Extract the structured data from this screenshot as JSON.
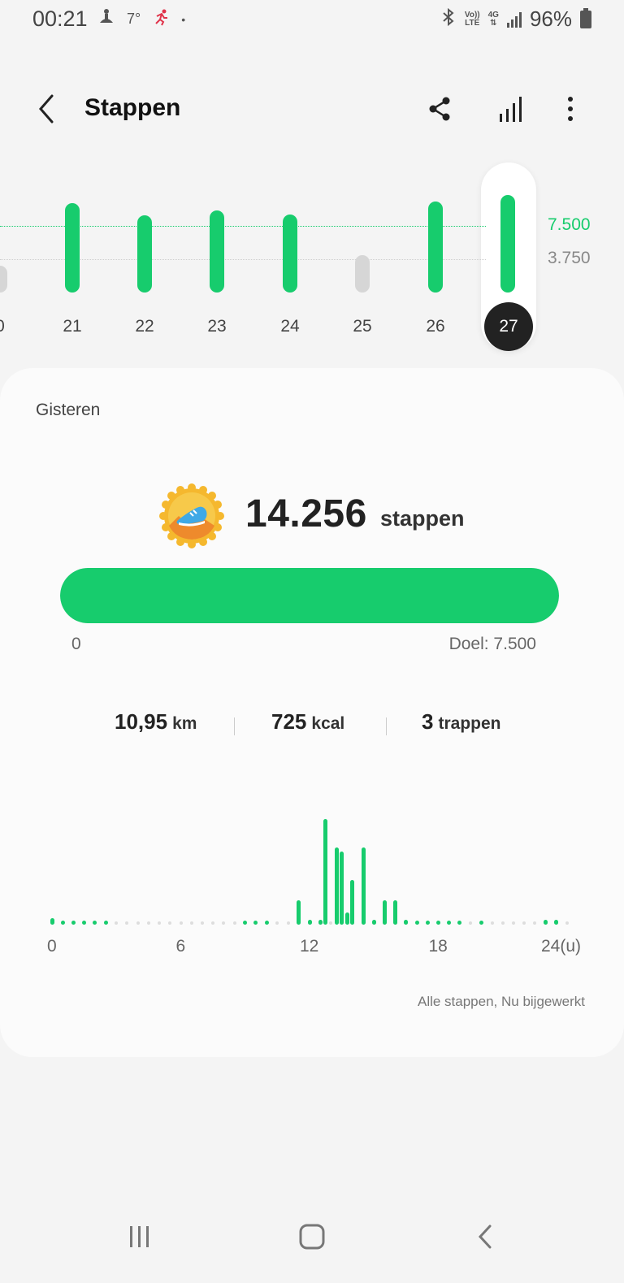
{
  "status_bar": {
    "time": "00:21",
    "temperature": "7°",
    "battery": "96%",
    "volte": "Vo)) LTE",
    "network": "4G"
  },
  "header": {
    "title": "Stappen",
    "back_icon": "chevron-left-icon",
    "share_icon": "share-icon",
    "trends_icon": "bar-chart-icon",
    "more_icon": "more-vertical-icon"
  },
  "week_chart": {
    "days": [
      "0",
      "21",
      "22",
      "23",
      "24",
      "25",
      "26",
      "27"
    ],
    "steps": [
      3000,
      10100,
      8700,
      9300,
      8800,
      4200,
      10300,
      11000
    ],
    "goal_reached": [
      false,
      true,
      true,
      true,
      true,
      false,
      true,
      true
    ],
    "selected_day": "27",
    "goal_label": "7.500",
    "half_goal_label": "3.750",
    "goal_value": 7500,
    "half_goal_value": 3750,
    "colors": {
      "green": "#17cc6d",
      "grey": "#d6d6d6"
    }
  },
  "card": {
    "day_label": "Gisteren",
    "steps_count": "14.256",
    "steps_unit": "stappen",
    "progress_fraction": 1.0,
    "progress_min": "0",
    "progress_goal": "Doel: 7.500",
    "distance_value": "10,95",
    "distance_unit": "km",
    "calories_value": "725",
    "calories_unit": "kcal",
    "floors_value": "3",
    "floors_unit": "trappen",
    "hour_labels": [
      "0",
      "6",
      "12",
      "18",
      "24(u)"
    ],
    "footnote": "Alle stappen, Nu bijgewerkt"
  },
  "chart_data": {
    "type": "bar",
    "title": "",
    "xlabel": "",
    "ylabel": "",
    "x_unit": "u",
    "x_range": [
      0,
      24
    ],
    "x": [
      0,
      0.5,
      1,
      1.5,
      2,
      2.5,
      9,
      9.5,
      10,
      11.5,
      12,
      12.5,
      12.75,
      13.25,
      13.5,
      13.75,
      14,
      14.5,
      15,
      15.5,
      16,
      16.5,
      17,
      17.5,
      18,
      18.5,
      19,
      20,
      23,
      23.5
    ],
    "values": [
      8,
      4,
      4,
      4,
      4,
      4,
      4,
      4,
      4,
      30,
      6,
      6,
      130,
      95,
      90,
      15,
      55,
      95,
      6,
      30,
      30,
      6,
      4,
      4,
      4,
      4,
      4,
      4,
      6,
      6
    ]
  }
}
